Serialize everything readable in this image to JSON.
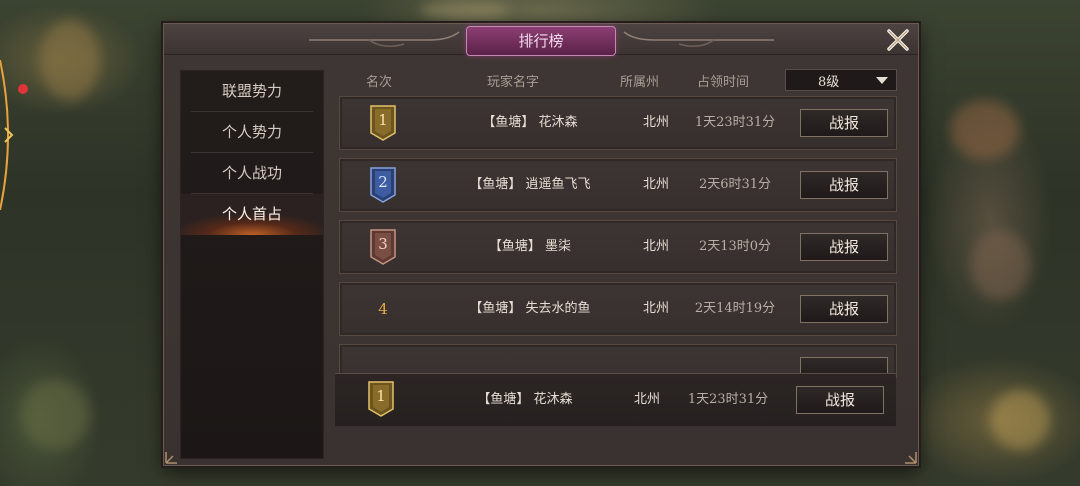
{
  "ui": {
    "title": "排行榜",
    "colors": {
      "accent": "#8c3f73",
      "rank_gold": "#d9b24b",
      "rank_blue": "#4a6fb5",
      "rank_bronze": "#a06a58"
    }
  },
  "sidebar": {
    "tabs": [
      {
        "label": "联盟势力",
        "active": false
      },
      {
        "label": "个人势力",
        "active": false
      },
      {
        "label": "个人战功",
        "active": false
      },
      {
        "label": "个人首占",
        "active": true
      }
    ]
  },
  "table": {
    "headers": {
      "rank": "名次",
      "player": "玩家名字",
      "state": "所属州",
      "occupy_time": "占领时间"
    },
    "level_filter": "8级",
    "rows": [
      {
        "rank": "1",
        "name": "【鱼塘】 花沐森",
        "state": "北州",
        "time": "1天23时31分",
        "action": "战报"
      },
      {
        "rank": "2",
        "name": "【鱼塘】 逍遥鱼飞飞",
        "state": "北州",
        "time": "2天6时31分",
        "action": "战报"
      },
      {
        "rank": "3",
        "name": "【鱼塘】 墨柒",
        "state": "北州",
        "time": "2天13时0分",
        "action": "战报"
      },
      {
        "rank": "4",
        "name": "【鱼塘】 失去水的鱼",
        "state": "北州",
        "time": "2天14时19分",
        "action": "战报"
      }
    ]
  },
  "my_rank": {
    "rank": "1",
    "name": "【鱼塘】 花沐森",
    "state": "北州",
    "time": "1天23时31分",
    "action": "战报"
  }
}
